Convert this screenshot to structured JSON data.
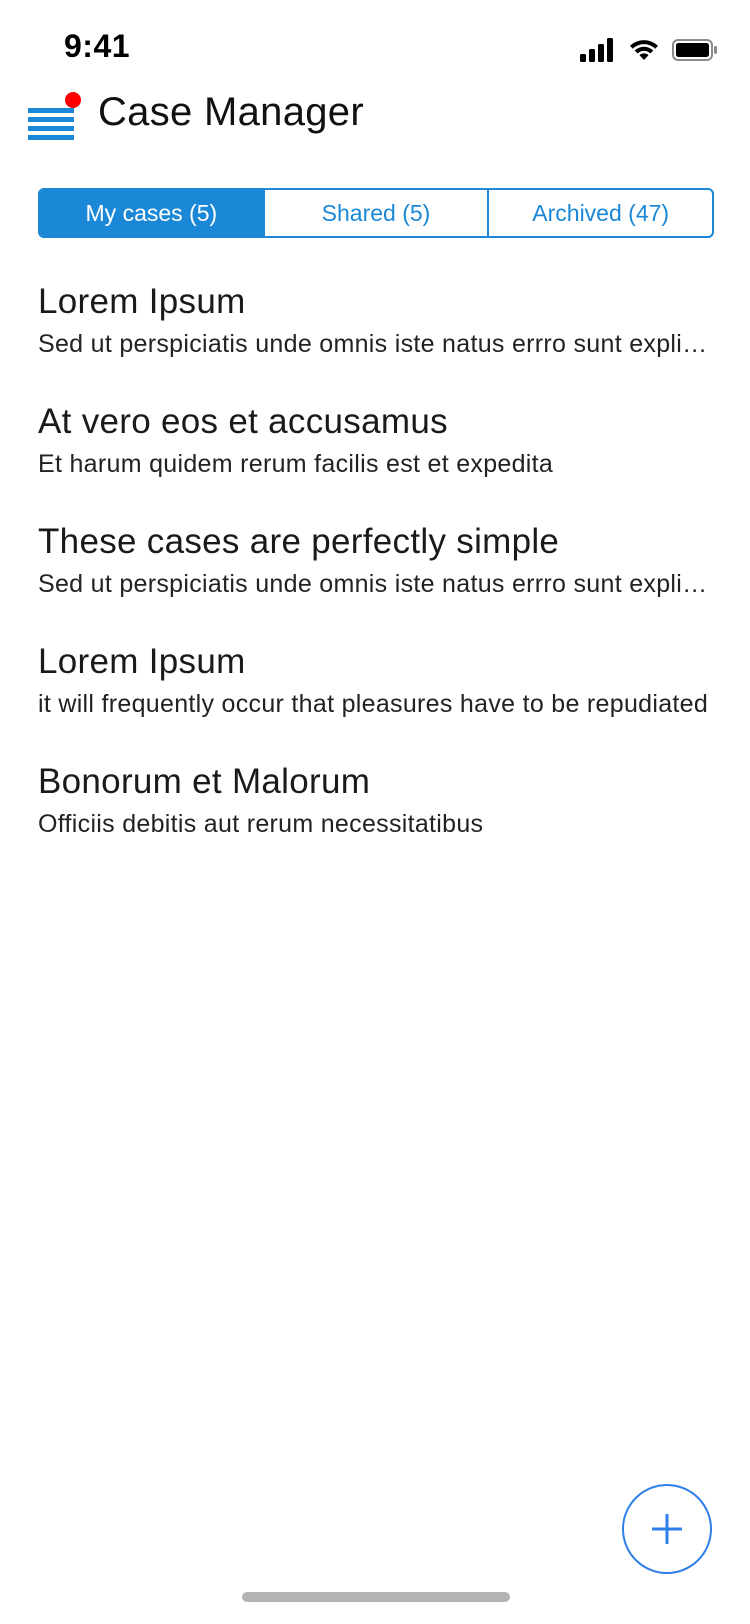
{
  "status_bar": {
    "time": "9:41",
    "icons": [
      "signal-icon",
      "wifi-icon",
      "battery-icon"
    ]
  },
  "header": {
    "title": "Case Manager",
    "menu_icon": "hamburger-menu-icon",
    "notification_dot_color": "#ff0000"
  },
  "tabs": [
    {
      "label": "My cases (5)",
      "active": true
    },
    {
      "label": "Shared (5)",
      "active": false
    },
    {
      "label": "Archived (47)",
      "active": false
    }
  ],
  "cases": [
    {
      "title": "Lorem Ipsum",
      "description": "Sed ut perspiciatis unde omnis iste natus errro sunt explicabo"
    },
    {
      "title": "At vero eos et accusamus",
      "description": "Et harum quidem rerum facilis est et expedita"
    },
    {
      "title": "These cases are perfectly simple",
      "description": "Sed ut perspiciatis unde omnis iste natus errro sunt explicabo"
    },
    {
      "title": "Lorem Ipsum",
      "description": "it will frequently occur that pleasures have to be repudiated"
    },
    {
      "title": "Bonorum et Malorum",
      "description": "Officiis debitis aut rerum necessitatibus"
    }
  ],
  "fab": {
    "icon": "plus-icon"
  },
  "colors": {
    "accent": "#1a88d6",
    "fab_accent": "#2f7fe8",
    "notification": "#ff0000"
  }
}
